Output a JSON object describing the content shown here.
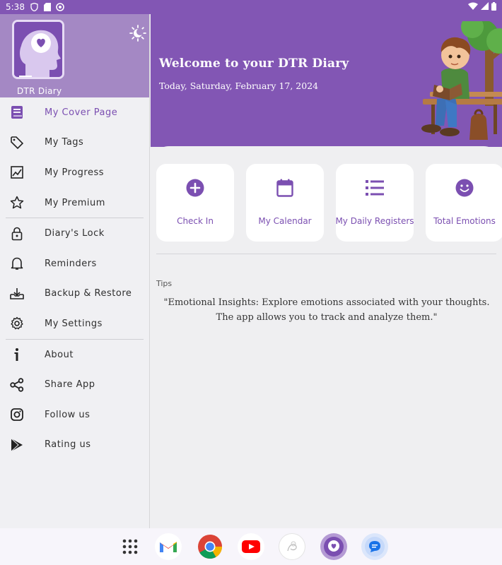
{
  "status_bar": {
    "time": "5:38",
    "left_icons": [
      "vpn-shield-icon",
      "sd-card-icon",
      "sync-icon"
    ],
    "right_icons": [
      "wifi-icon",
      "signal-icon",
      "battery-icon"
    ]
  },
  "drawer": {
    "app_name": "DTR Diary",
    "menu": [
      {
        "label": "My Cover Page",
        "icon": "book-icon",
        "active": true
      },
      {
        "label": "My Tags",
        "icon": "tag-icon"
      },
      {
        "label": "My Progress",
        "icon": "progress-chart-icon"
      },
      {
        "label": "My Premium",
        "icon": "star-icon"
      },
      {
        "label": "Diary's Lock",
        "icon": "lock-icon"
      },
      {
        "label": "Reminders",
        "icon": "bell-icon"
      },
      {
        "label": "Backup & Restore",
        "icon": "backup-icon"
      },
      {
        "label": "My Settings",
        "icon": "gear-icon"
      },
      {
        "label": "About",
        "icon": "info-icon"
      },
      {
        "label": "Share App",
        "icon": "share-icon"
      },
      {
        "label": "Follow us",
        "icon": "instagram-icon"
      },
      {
        "label": "Rating us",
        "icon": "play-store-icon"
      }
    ]
  },
  "hero": {
    "title": "Welcome to your DTR Diary",
    "date": "Today, Saturday, February 17, 2024"
  },
  "cards": [
    {
      "label": "Check In",
      "icon": "plus-circle-icon"
    },
    {
      "label": "My Calendar",
      "icon": "calendar-icon"
    },
    {
      "label": "My Daily Registers",
      "icon": "list-icon"
    },
    {
      "label": "Total Emotions",
      "icon": "smiley-icon"
    }
  ],
  "tips": {
    "label": "Tips",
    "text": "\"Emotional Insights: Explore emotions associated with your thoughts. The app allows you to track and analyze them.\""
  },
  "dock": [
    {
      "icon": "app-grid-icon"
    },
    {
      "icon": "gmail-icon"
    },
    {
      "icon": "chrome-icon"
    },
    {
      "icon": "youtube-icon"
    },
    {
      "icon": "sketch-app-icon"
    },
    {
      "icon": "dtr-diary-icon"
    },
    {
      "icon": "messages-icon"
    }
  ],
  "colors": {
    "primary": "#8256b4",
    "drawer_header": "#a488c4",
    "accent_text": "#7b4fb1",
    "background": "#efeff1"
  }
}
